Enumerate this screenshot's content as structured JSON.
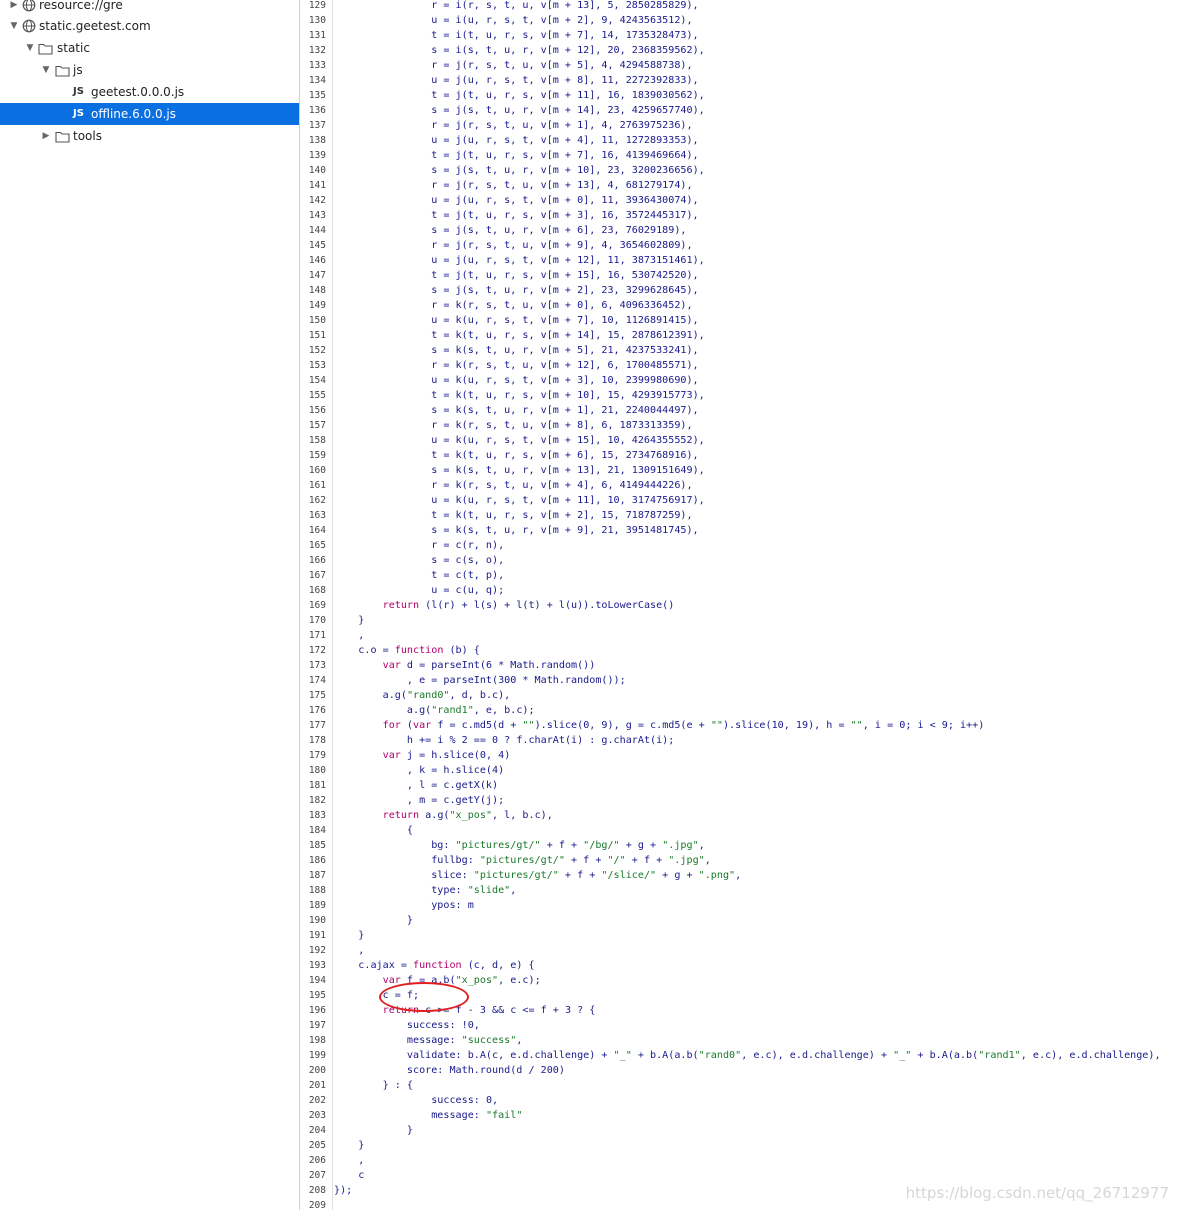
{
  "sidebar": {
    "items": [
      {
        "label": "resource://gre",
        "type": "domain"
      },
      {
        "label": "static.geetest.com",
        "type": "domain"
      },
      {
        "label": "static",
        "type": "folder"
      },
      {
        "label": "js",
        "type": "folder"
      },
      {
        "label": "geetest.0.0.0.js",
        "type": "file",
        "badge": "JS"
      },
      {
        "label": "offline.6.0.0.js",
        "type": "file",
        "badge": "JS",
        "selected": true
      },
      {
        "label": "tools",
        "type": "folder"
      }
    ]
  },
  "editor": {
    "first_line": 129,
    "lines": [
      "                r = i(r, s, t, u, v[m + 13], 5, 2850285829),",
      "                u = i(u, r, s, t, v[m + 2], 9, 4243563512),",
      "                t = i(t, u, r, s, v[m + 7], 14, 1735328473),",
      "                s = i(s, t, u, r, v[m + 12], 20, 2368359562),",
      "                r = j(r, s, t, u, v[m + 5], 4, 4294588738),",
      "                u = j(u, r, s, t, v[m + 8], 11, 2272392833),",
      "                t = j(t, u, r, s, v[m + 11], 16, 1839030562),",
      "                s = j(s, t, u, r, v[m + 14], 23, 4259657740),",
      "                r = j(r, s, t, u, v[m + 1], 4, 2763975236),",
      "                u = j(u, r, s, t, v[m + 4], 11, 1272893353),",
      "                t = j(t, u, r, s, v[m + 7], 16, 4139469664),",
      "                s = j(s, t, u, r, v[m + 10], 23, 3200236656),",
      "                r = j(r, s, t, u, v[m + 13], 4, 681279174),",
      "                u = j(u, r, s, t, v[m + 0], 11, 3936430074),",
      "                t = j(t, u, r, s, v[m + 3], 16, 3572445317),",
      "                s = j(s, t, u, r, v[m + 6], 23, 76029189),",
      "                r = j(r, s, t, u, v[m + 9], 4, 3654602809),",
      "                u = j(u, r, s, t, v[m + 12], 11, 3873151461),",
      "                t = j(t, u, r, s, v[m + 15], 16, 530742520),",
      "                s = j(s, t, u, r, v[m + 2], 23, 3299628645),",
      "                r = k(r, s, t, u, v[m + 0], 6, 4096336452),",
      "                u = k(u, r, s, t, v[m + 7], 10, 1126891415),",
      "                t = k(t, u, r, s, v[m + 14], 15, 2878612391),",
      "                s = k(s, t, u, r, v[m + 5], 21, 4237533241),",
      "                r = k(r, s, t, u, v[m + 12], 6, 1700485571),",
      "                u = k(u, r, s, t, v[m + 3], 10, 2399980690),",
      "                t = k(t, u, r, s, v[m + 10], 15, 4293915773),",
      "                s = k(s, t, u, r, v[m + 1], 21, 2240044497),",
      "                r = k(r, s, t, u, v[m + 8], 6, 1873313359),",
      "                u = k(u, r, s, t, v[m + 15], 10, 4264355552),",
      "                t = k(t, u, r, s, v[m + 6], 15, 2734768916),",
      "                s = k(s, t, u, r, v[m + 13], 21, 1309151649),",
      "                r = k(r, s, t, u, v[m + 4], 6, 4149444226),",
      "                u = k(u, r, s, t, v[m + 11], 10, 3174756917),",
      "                t = k(t, u, r, s, v[m + 2], 15, 718787259),",
      "                s = k(s, t, u, r, v[m + 9], 21, 3951481745),",
      "                r = c(r, n),",
      "                s = c(s, o),",
      "                t = c(t, p),",
      "                u = c(u, q);",
      "        return (l(r) + l(s) + l(t) + l(u)).toLowerCase()",
      "    }",
      "    ,",
      "    c.o = function (b) {",
      "        var d = parseInt(6 * Math.random())",
      "            , e = parseInt(300 * Math.random());",
      "        a.g(\"rand0\", d, b.c),",
      "            a.g(\"rand1\", e, b.c);",
      "        for (var f = c.md5(d + \"\").slice(0, 9), g = c.md5(e + \"\").slice(10, 19), h = \"\", i = 0; i < 9; i++)",
      "            h += i % 2 == 0 ? f.charAt(i) : g.charAt(i);",
      "        var j = h.slice(0, 4)",
      "            , k = h.slice(4)",
      "            , l = c.getX(k)",
      "            , m = c.getY(j);",
      "        return a.g(\"x_pos\", l, b.c),",
      "            {",
      "                bg: \"pictures/gt/\" + f + \"/bg/\" + g + \".jpg\",",
      "                fullbg: \"pictures/gt/\" + f + \"/\" + f + \".jpg\",",
      "                slice: \"pictures/gt/\" + f + \"/slice/\" + g + \".png\",",
      "                type: \"slide\",",
      "                ypos: m",
      "            }",
      "    }",
      "    ,",
      "    c.ajax = function (c, d, e) {",
      "        var f = a.b(\"x_pos\", e.c);",
      "        c = f;",
      "        return c >= f - 3 && c <= f + 3 ? {",
      "            success: !0,",
      "            message: \"success\",",
      "            validate: b.A(c, e.d.challenge) + \"_\" + b.A(a.b(\"rand0\", e.c), e.d.challenge) + \"_\" + b.A(a.b(\"rand1\", e.c), e.d.challenge),",
      "            score: Math.round(d / 200)",
      "        } : {",
      "                success: 0,",
      "                message: \"fail\"",
      "            }",
      "    }",
      "    ,",
      "    c",
      "});",
      ""
    ]
  },
  "watermark": "https://blog.csdn.net/qq_26712977",
  "colors": {
    "selection": "#0a6fe0",
    "annotation_circle": "#e02020"
  }
}
